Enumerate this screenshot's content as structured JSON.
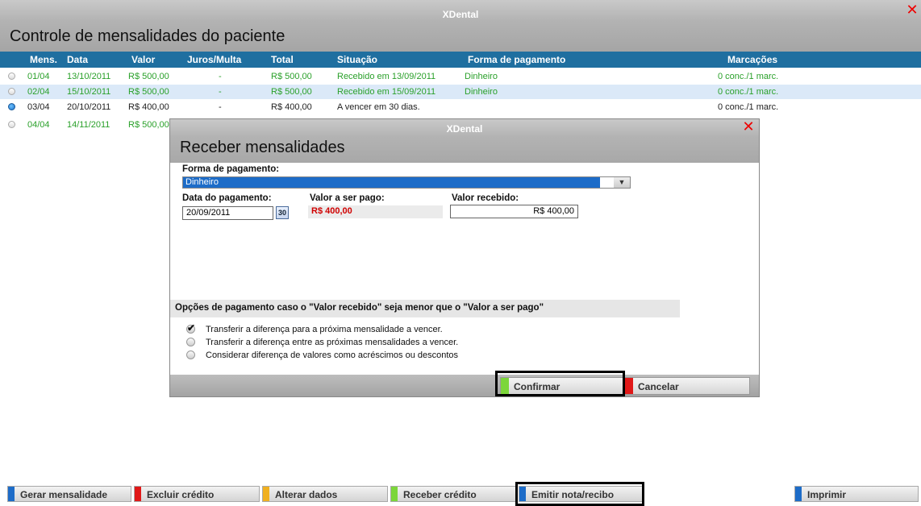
{
  "main": {
    "app_title": "XDental",
    "close_glyph": "✕",
    "page_title": "Controle de mensalidades do paciente",
    "columns": [
      "Mens.",
      "Data",
      "Valor",
      "Juros/Multa",
      "Total",
      "Situação",
      "Forma de pagamento",
      "Marcações"
    ],
    "rows": [
      {
        "mens": "01/04",
        "data": "13/10/2011",
        "valor": "R$ 500,00",
        "juros": "-",
        "total": "R$ 500,00",
        "situacao": "Recebido em 13/09/2011",
        "forma": "Dinheiro",
        "marcacoes": "0 conc./1 marc.",
        "status": "paid",
        "selected": false
      },
      {
        "mens": "02/04",
        "data": "15/10/2011",
        "valor": "R$ 500,00",
        "juros": "-",
        "total": "R$ 500,00",
        "situacao": "Recebido em 15/09/2011",
        "forma": "Dinheiro",
        "marcacoes": "0 conc./1 marc.",
        "status": "paid",
        "selected": false
      },
      {
        "mens": "03/04",
        "data": "20/10/2011",
        "valor": "R$ 400,00",
        "juros": "-",
        "total": "R$ 400,00",
        "situacao": "A vencer em 30 dias.",
        "forma": "",
        "marcacoes": "0 conc./1 marc.",
        "status": "pending",
        "selected": true
      },
      {
        "mens": "04/04",
        "data": "14/11/2011",
        "valor": "R$ 500,00",
        "status": "paid",
        "selected": false
      }
    ]
  },
  "toolbar": {
    "buttons": [
      {
        "label": "Gerar mensalidade",
        "color": "#1d6cc8"
      },
      {
        "label": "Excluir crédito",
        "color": "#e01818"
      },
      {
        "label": "Alterar dados",
        "color": "#f0b020"
      },
      {
        "label": "Receber crédito",
        "color": "#7cd63a"
      },
      {
        "label": "Emitir nota/recibo",
        "color": "#1d6cc8"
      },
      {
        "label": "Imprimir",
        "color": "#1d6cc8"
      }
    ]
  },
  "dialog": {
    "app_title": "XDental",
    "close_glyph": "✕",
    "title": "Receber mensalidades",
    "payment_method_label": "Forma de pagamento:",
    "payment_method_value": "Dinheiro",
    "payment_date_label": "Data do pagamento:",
    "payment_date_value": "20/09/2011",
    "calendar_icon_text": "30",
    "amount_due_label": "Valor a ser pago:",
    "amount_due_value": "R$ 400,00",
    "amount_received_label": "Valor recebido:",
    "amount_received_value": "R$ 400,00",
    "options_title": "Opções de pagamento caso o \"Valor recebido\" seja menor que o \"Valor a ser pago\"",
    "options": [
      {
        "label": "Transferir a diferença para a próxima mensalidade a vencer.",
        "checked": true
      },
      {
        "label": "Transferir a diferença entre as próximas mensalidades a vencer.",
        "checked": false
      },
      {
        "label": "Considerar diferença de valores como acréscimos ou descontos",
        "checked": false
      }
    ],
    "confirm_label": "Confirmar",
    "cancel_label": "Cancelar",
    "confirm_color": "#7cd63a",
    "cancel_color": "#e01818"
  },
  "colors": {
    "header_blue": "#1f6fa0",
    "row_highlight": "#dbe9f8",
    "paid_green": "#2aa02a",
    "due_red": "#d00000"
  }
}
